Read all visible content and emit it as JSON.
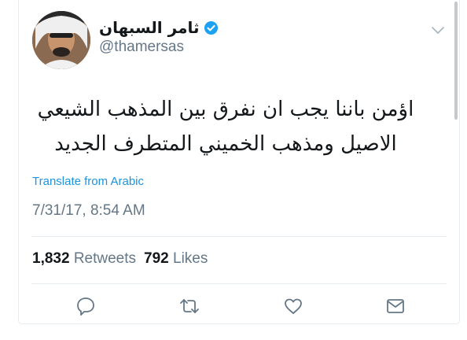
{
  "tweet": {
    "display_name": "ثامر السبهان",
    "handle": "@thamersas",
    "verified": true,
    "text_line_1": "اؤمن باننا يجب ان نفرق بين المذهب الشيعي",
    "text_line_2": "الاصيل ومذهب الخميني المتطرف الجديد",
    "translate_label": "Translate from Arabic",
    "timestamp": "7/31/17, 8:54 AM",
    "retweets_count": "1,832",
    "retweets_label": "Retweets",
    "likes_count": "792",
    "likes_label": "Likes"
  },
  "icons": {
    "verified": "verified-badge-icon",
    "caret": "chevron-down-icon",
    "reply": "reply-icon",
    "retweet": "retweet-icon",
    "like": "heart-icon",
    "dm": "envelope-icon"
  },
  "colors": {
    "link": "#1b95e0",
    "secondary_text": "#657786",
    "primary_text": "#14171a",
    "verified": "#1da1f2",
    "divider": "#e6ecf0"
  }
}
